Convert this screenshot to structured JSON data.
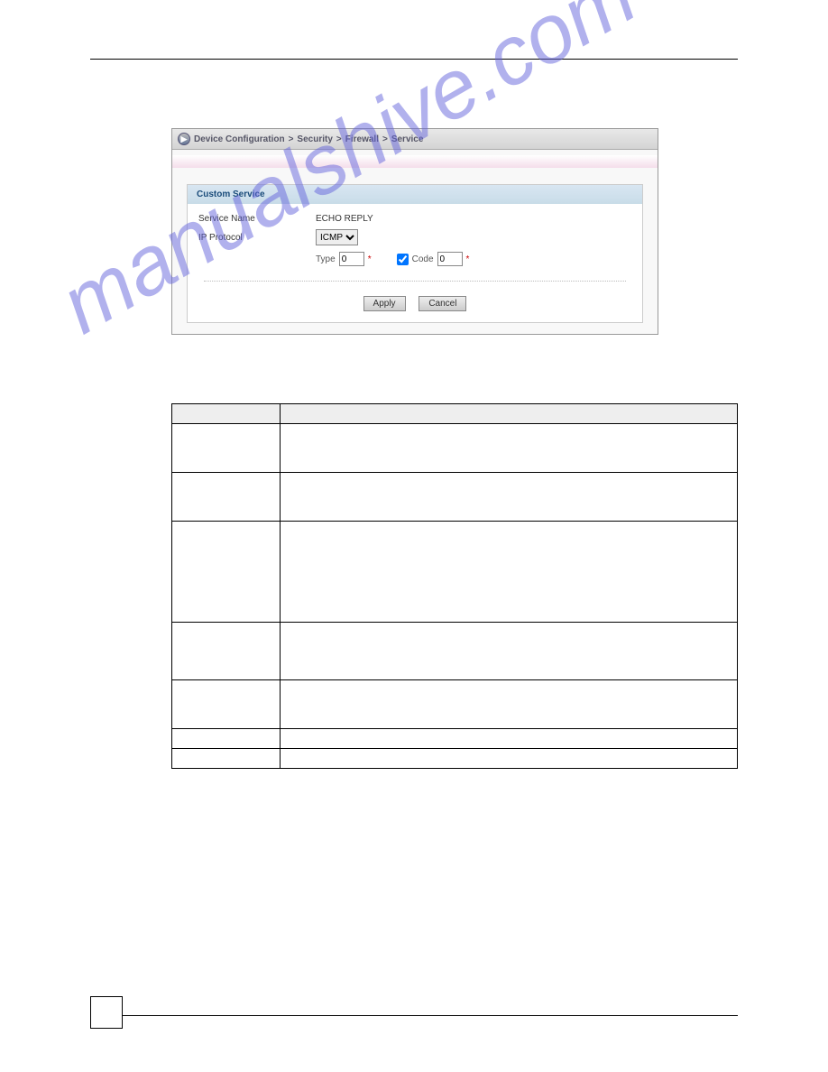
{
  "breadcrumb": {
    "icon": "▶",
    "segments": [
      "Device Configuration",
      "Security",
      "Firewall",
      "Service"
    ],
    "sep": ">"
  },
  "panel": {
    "title": "Custom Service",
    "rows": {
      "service_name": {
        "label": "Service Name",
        "value": "ECHO REPLY"
      },
      "ip_protocol": {
        "label": "IP Protocol",
        "selected": "ICMP"
      }
    },
    "sub": {
      "type_label": "Type",
      "type_value": "0",
      "code_label": "Code",
      "code_value": "0",
      "code_checked": true,
      "required_mark": "*"
    },
    "buttons": {
      "apply": "Apply",
      "cancel": "Cancel"
    }
  },
  "table": {
    "headers": [
      "",
      ""
    ],
    "rows": [
      [
        "",
        ""
      ],
      [
        "",
        ""
      ],
      [
        "",
        ""
      ],
      [
        "",
        ""
      ],
      [
        "",
        ""
      ],
      [
        "",
        ""
      ],
      [
        "",
        ""
      ]
    ]
  },
  "watermark": "manualshive.com"
}
